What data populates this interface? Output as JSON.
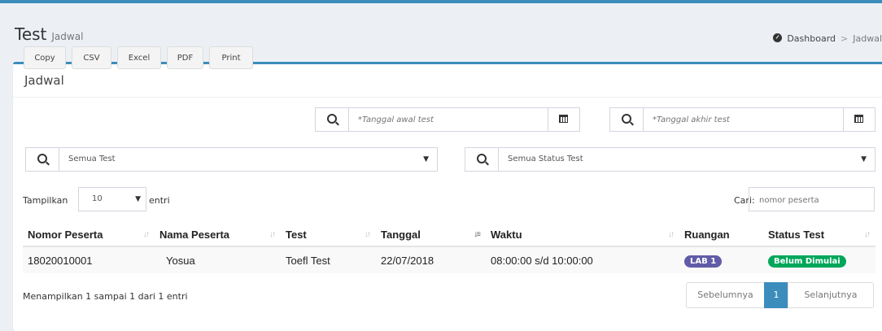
{
  "header": {
    "title": "Test",
    "subtitle": "Jadwal",
    "breadcrumb": {
      "home": "Dashboard",
      "separator": ">",
      "current": "Jadwal"
    }
  },
  "box": {
    "title": "Jadwal"
  },
  "export_buttons": [
    "Copy",
    "CSV",
    "Excel",
    "PDF",
    "Print"
  ],
  "filters": {
    "date_start_placeholder": "*Tanggal awal test",
    "date_end_placeholder": "*Tanggal akhir test",
    "test_select": "Semua Test",
    "status_select": "Semua Status Test"
  },
  "length": {
    "label": "Tampilkan",
    "value": "10",
    "suffix": "entri"
  },
  "search": {
    "label": "Cari:",
    "placeholder": "nomor peserta"
  },
  "table": {
    "columns": [
      "Nomor Peserta",
      "Nama Peserta",
      "Test",
      "Tanggal",
      "Waktu",
      "Ruangan",
      "Status Test"
    ],
    "rows": [
      {
        "nomor": "18020010001",
        "nama": "Yosua",
        "test": "Toefl Test",
        "tanggal": "22/07/2018",
        "waktu": "08:00:00 s/d 10:00:00",
        "ruangan": "LAB 1",
        "status": "Belum Dimulai"
      }
    ]
  },
  "info": "Menampilkan 1 sampai 1 dari 1 entri",
  "pagination": {
    "prev": "Sebelumnya",
    "current": "1",
    "next": "Selanjutnya"
  },
  "colors": {
    "primary": "#3c8dbc",
    "room_label": "#605ca8",
    "status_label": "#00a65a",
    "background": "#ecf0f5"
  },
  "icons": [
    "dashboard-icon",
    "search-icon",
    "calendar-icon",
    "caret-down-icon",
    "sort-icon"
  ]
}
